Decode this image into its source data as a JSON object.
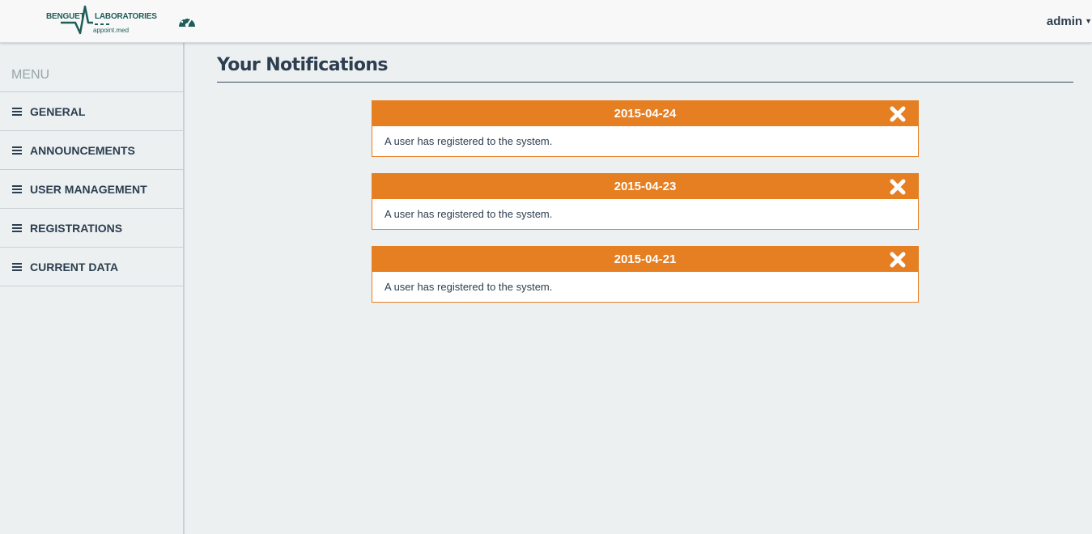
{
  "brand": {
    "word1": "BENGUET",
    "word2": "LABORATORIES",
    "sub": "appoint.med",
    "color": "#1d5e58"
  },
  "header": {
    "dashboard_icon": "speedometer-icon",
    "user_label": "admin",
    "user_caret_icon": "caret-down-icon"
  },
  "sidebar": {
    "title": "MENU",
    "item_icon": "hamburger-icon",
    "items": [
      {
        "label": "GENERAL"
      },
      {
        "label": "ANNOUNCEMENTS"
      },
      {
        "label": "USER MANAGEMENT"
      },
      {
        "label": "REGISTRATIONS"
      },
      {
        "label": "CURRENT DATA"
      }
    ]
  },
  "main": {
    "title": "Your Notifications",
    "accent_color": "#e67e22",
    "close_icon": "close-x-icon",
    "notifications": [
      {
        "date": "2015-04-24",
        "message": "A user has registered to the system."
      },
      {
        "date": "2015-04-23",
        "message": "A user has registered to the system."
      },
      {
        "date": "2015-04-21",
        "message": "A user has registered to the system."
      }
    ]
  }
}
